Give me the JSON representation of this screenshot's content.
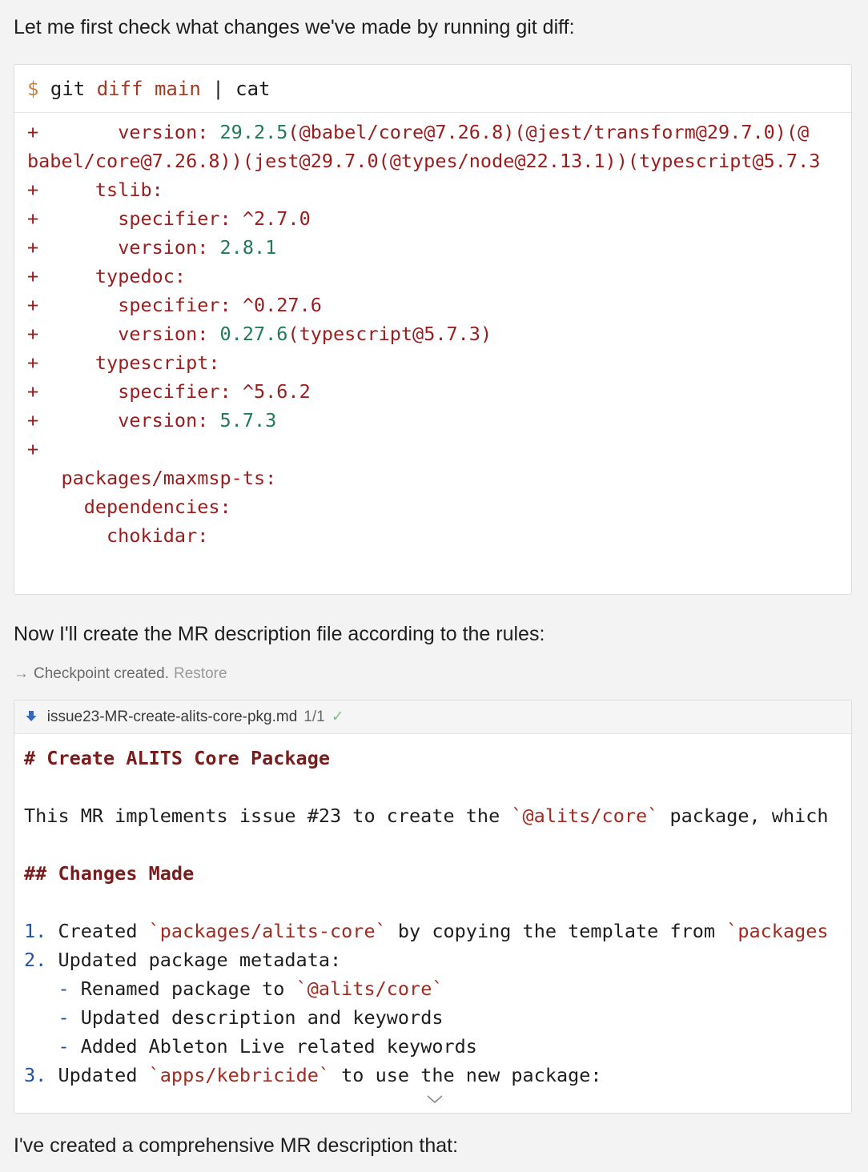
{
  "intro_text": "Let me first check what changes we've made by running git diff:",
  "terminal": {
    "prompt": "$",
    "cmd_git": "git",
    "cmd_diff": "diff",
    "cmd_main": "main",
    "cmd_rest": "| cat",
    "lines": [
      [
        "+",
        "       version: ",
        "29.2.5",
        "(@babel/core@7.26.8)(@jest/transform@29.7.0)(@"
      ],
      [
        "",
        "babel/core@7.26.8))(jest@29.7.0(@types/node@22.13.1))(typescript@5.7.3",
        "",
        ""
      ],
      [
        "+",
        "     tslib:",
        "",
        ""
      ],
      [
        "+",
        "       specifier: ^2.7.0",
        "",
        ""
      ],
      [
        "+",
        "       version: ",
        "2.8.1",
        ""
      ],
      [
        "+",
        "     typedoc:",
        "",
        ""
      ],
      [
        "+",
        "       specifier: ^0.27.6",
        "",
        ""
      ],
      [
        "+",
        "       version: ",
        "0.27.6",
        "(typescript@5.7.3)"
      ],
      [
        "+",
        "     typescript:",
        "",
        ""
      ],
      [
        "+",
        "       specifier: ^5.6.2",
        "",
        ""
      ],
      [
        "+",
        "       version: ",
        "5.7.3",
        ""
      ],
      [
        "+",
        "",
        "",
        ""
      ],
      [
        "",
        "   packages/maxmsp-ts:",
        "",
        ""
      ],
      [
        "",
        "     dependencies:",
        "",
        ""
      ],
      [
        "",
        "       chokidar:",
        "",
        ""
      ]
    ]
  },
  "second_text": "Now I'll create the MR description file according to the rules:",
  "checkpoint": {
    "arrow": "→",
    "label": "Checkpoint created.",
    "restore": "Restore"
  },
  "file": {
    "name": "issue23-MR-create-alits-core-pkg.md",
    "count": "1/1",
    "check": "✓",
    "lines": [
      {
        "t": "h",
        "text": "# Create ALITS Core Package"
      },
      {
        "t": "blank"
      },
      {
        "t": "seg",
        "segs": [
          [
            "p",
            "This MR implements issue #23 to create the "
          ],
          [
            "c",
            "`@alits/core`"
          ],
          [
            "p",
            " package, which"
          ]
        ]
      },
      {
        "t": "blank"
      },
      {
        "t": "h",
        "text": "## Changes Made"
      },
      {
        "t": "blank"
      },
      {
        "t": "seg",
        "segs": [
          [
            "n",
            "1."
          ],
          [
            "p",
            " Created "
          ],
          [
            "c",
            "`packages/alits-core`"
          ],
          [
            "p",
            " by copying the template from "
          ],
          [
            "c",
            "`packages"
          ]
        ]
      },
      {
        "t": "seg",
        "segs": [
          [
            "n",
            "2."
          ],
          [
            "p",
            " Updated package metadata:"
          ]
        ]
      },
      {
        "t": "seg",
        "segs": [
          [
            "p",
            "   "
          ],
          [
            "d",
            "-"
          ],
          [
            "p",
            " Renamed package to "
          ],
          [
            "c",
            "`@alits/core`"
          ]
        ]
      },
      {
        "t": "seg",
        "segs": [
          [
            "p",
            "   "
          ],
          [
            "d",
            "-"
          ],
          [
            "p",
            " Updated description and keywords"
          ]
        ]
      },
      {
        "t": "seg",
        "segs": [
          [
            "p",
            "   "
          ],
          [
            "d",
            "-"
          ],
          [
            "p",
            " Added Ableton Live related keywords"
          ]
        ]
      },
      {
        "t": "seg",
        "segs": [
          [
            "n",
            "3."
          ],
          [
            "p",
            " Updated "
          ],
          [
            "c",
            "`apps/kebricide`"
          ],
          [
            "p",
            " to use the new package:"
          ]
        ]
      }
    ]
  },
  "closing_text": "I've created a comprehensive MR description that:"
}
